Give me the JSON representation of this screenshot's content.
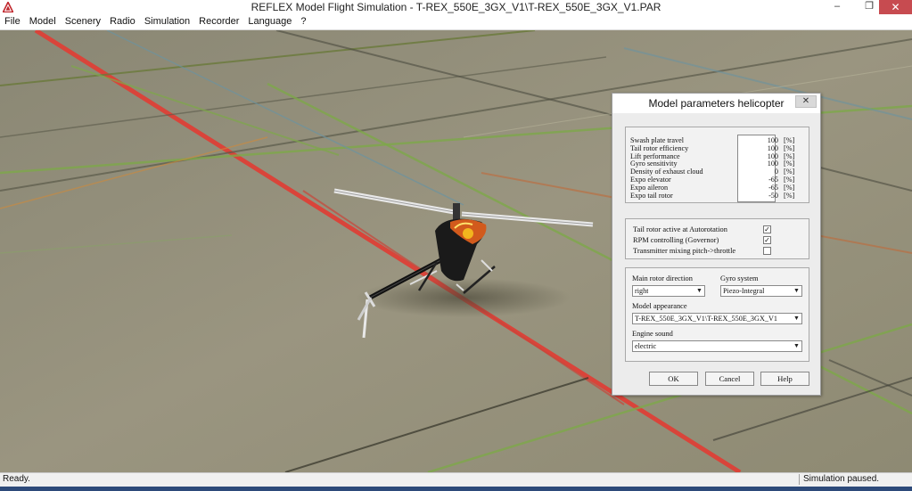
{
  "window": {
    "title": "REFLEX Model Flight Simulation - T-REX_550E_3GX_V1\\T-REX_550E_3GX_V1.PAR",
    "minimize_icon": "minimize-icon",
    "maximize_icon": "maximize-icon",
    "close_icon": "close-icon"
  },
  "menu": [
    "File",
    "Model",
    "Scenery",
    "Radio",
    "Simulation",
    "Recorder",
    "Language",
    "?"
  ],
  "status": {
    "left": "Ready.",
    "right": "Simulation paused."
  },
  "dialog": {
    "title": "Model parameters helicopter",
    "params": [
      {
        "name": "Swash plate travel",
        "value": "100",
        "unit": "[%]"
      },
      {
        "name": "Tail rotor efficiency",
        "value": "100",
        "unit": "[%]"
      },
      {
        "name": "Lift performance",
        "value": "100",
        "unit": "[%]"
      },
      {
        "name": "Gyro sensitivity",
        "value": "100",
        "unit": "[%]"
      },
      {
        "name": "Density of exhaust cloud",
        "value": "0",
        "unit": "[%]"
      },
      {
        "name": "Expo elevator",
        "value": "-65",
        "unit": "[%]"
      },
      {
        "name": "Expo aileron",
        "value": "-65",
        "unit": "[%]"
      },
      {
        "name": "Expo tail rotor",
        "value": "-50",
        "unit": "[%]"
      }
    ],
    "checks": [
      {
        "label": "Tail rotor active at Autorotation",
        "checked": true
      },
      {
        "label": "RPM controlling (Governor)",
        "checked": true
      },
      {
        "label": "Transmitter mixing pitch->throttle",
        "checked": false
      }
    ],
    "main_rotor_label": "Main rotor direction",
    "main_rotor_value": "right",
    "gyro_label": "Gyro system",
    "gyro_value": "Piezo-Integral",
    "appearance_label": "Model appearance",
    "appearance_value": "T-REX_550E_3GX_V1\\T-REX_550E_3GX_V1",
    "engine_label": "Engine sound",
    "engine_value": "electric",
    "ok": "OK",
    "cancel": "Cancel",
    "help": "Help"
  }
}
